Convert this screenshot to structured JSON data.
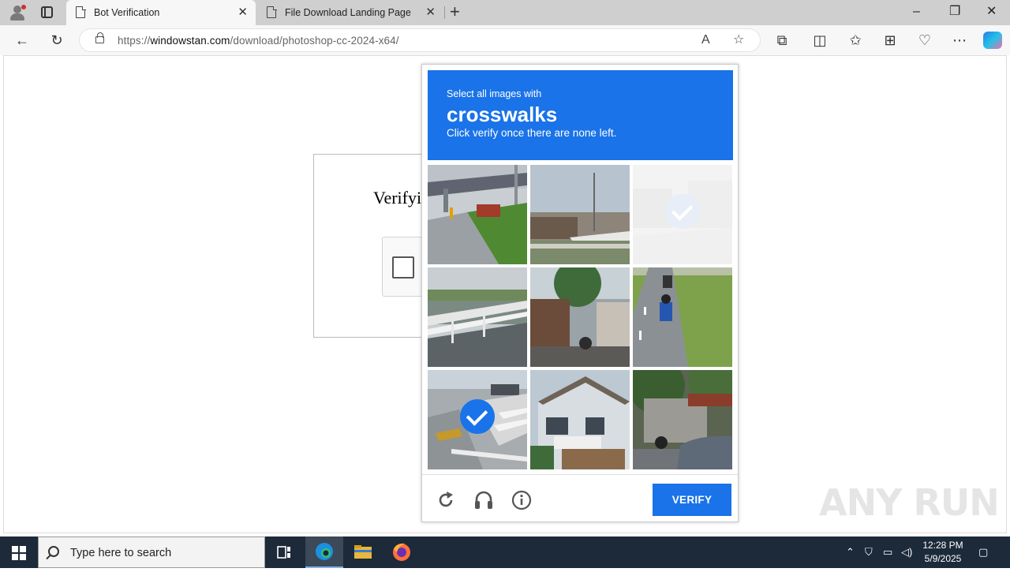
{
  "browser": {
    "tabs": [
      {
        "title": "Bot Verification",
        "active": true
      },
      {
        "title": "File Download Landing Page",
        "active": false
      }
    ],
    "url_prefix": "https://",
    "url_domain": "windowstan.com",
    "url_path": "/download/photoshop-cc-2024-x64/"
  },
  "page": {
    "card_title": "Verifyi"
  },
  "captcha": {
    "instruction": "Select all images with",
    "keyword": "crosswalks",
    "hint": "Click verify once there are none left.",
    "tiles": [
      {
        "scene": "overpass-road",
        "selected": false
      },
      {
        "scene": "boats-dock",
        "selected": false
      },
      {
        "scene": "faded-street",
        "selected": true,
        "faded": true
      },
      {
        "scene": "bridge-railing",
        "selected": false
      },
      {
        "scene": "street-houses",
        "selected": false
      },
      {
        "scene": "motorcycle-road",
        "selected": false
      },
      {
        "scene": "crosswalk-intersection",
        "selected": true
      },
      {
        "scene": "house",
        "selected": false
      },
      {
        "scene": "parked-car",
        "selected": false
      }
    ],
    "verify_label": "VERIFY"
  },
  "watermark": "ANY RUN",
  "taskbar": {
    "search_placeholder": "Type here to search",
    "time": "12:28 PM",
    "date": "5/9/2025"
  },
  "colors": {
    "captcha_blue": "#1a73e8",
    "taskbar": "#1c2a3a"
  }
}
